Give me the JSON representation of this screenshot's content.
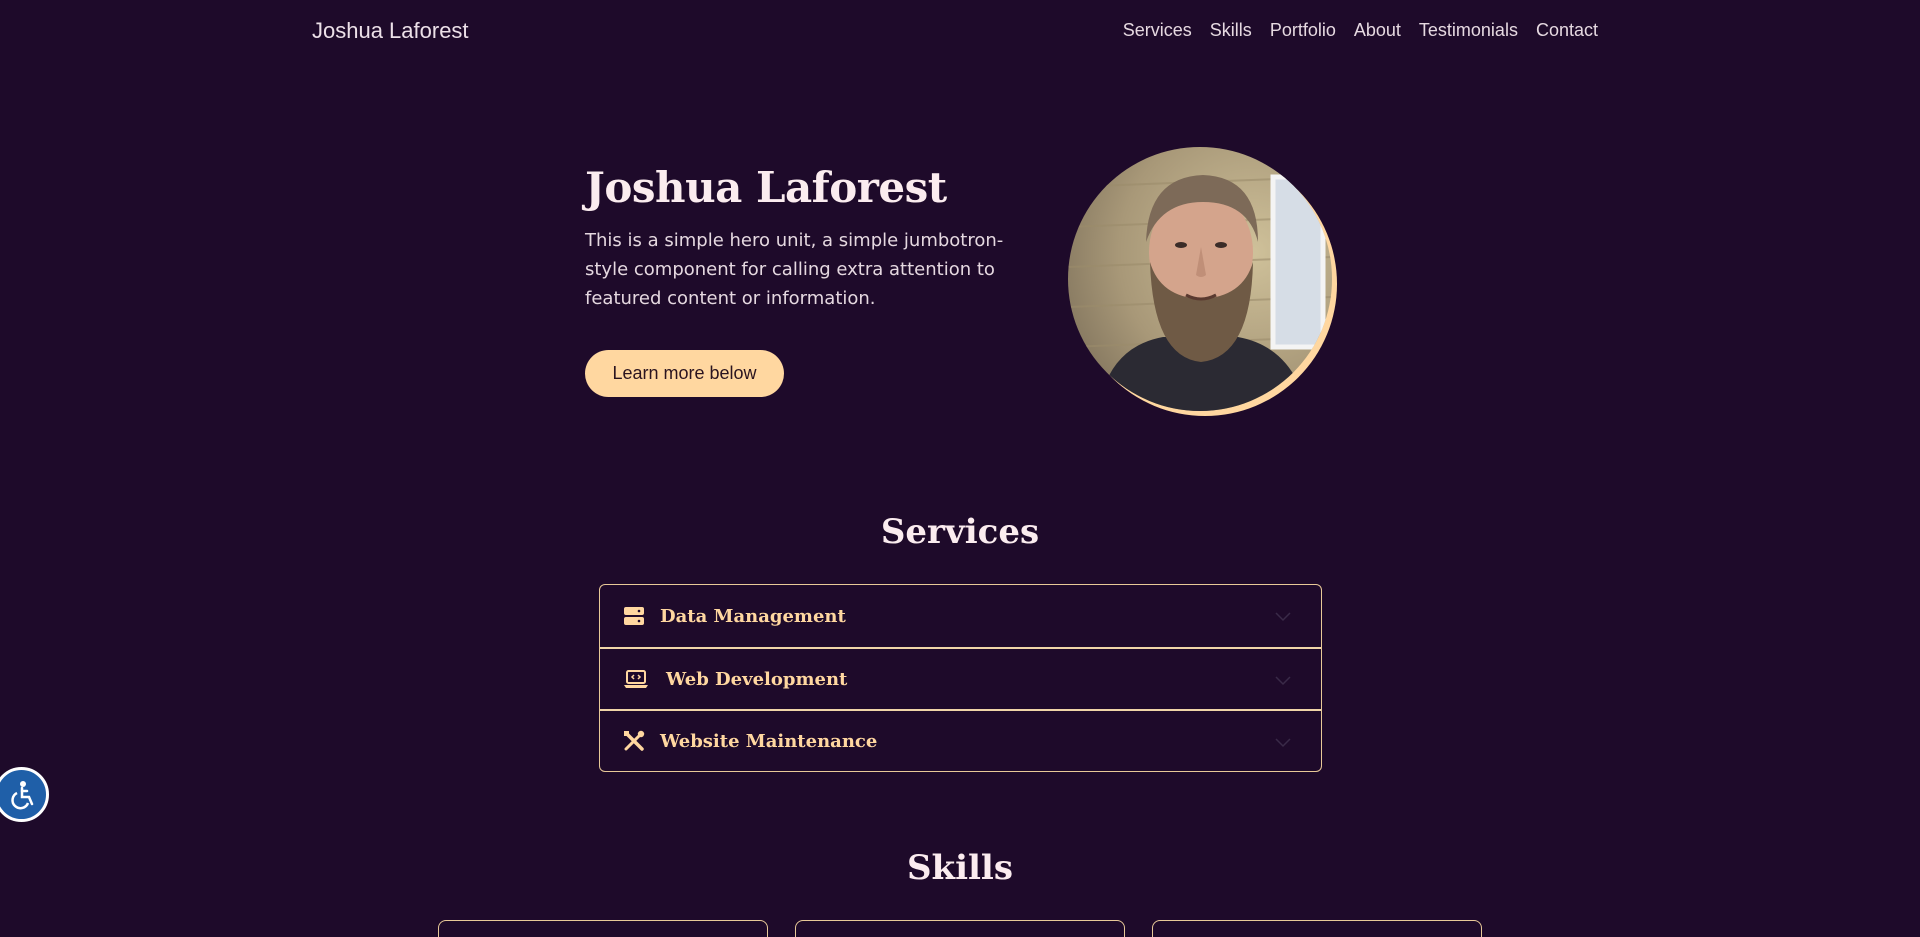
{
  "nav": {
    "brand": "Joshua Laforest",
    "links": [
      "Services",
      "Skills",
      "Portfolio",
      "About",
      "Testimonials",
      "Contact"
    ]
  },
  "hero": {
    "title": "Joshua Laforest",
    "text": "This is a simple hero unit, a simple jumbotron-style component for calling extra attention to featured content or information.",
    "button": "Learn more below"
  },
  "services": {
    "title": "Services",
    "items": [
      {
        "label": "Data Management",
        "icon": "server-icon"
      },
      {
        "label": "Web Development",
        "icon": "laptop-code-icon"
      },
      {
        "label": "Website Maintenance",
        "icon": "tools-icon"
      }
    ]
  },
  "skills": {
    "title": "Skills"
  },
  "colors": {
    "background": "#1e0a2a",
    "accent": "#ffd7a0",
    "a11y": "#1f5fa8"
  }
}
